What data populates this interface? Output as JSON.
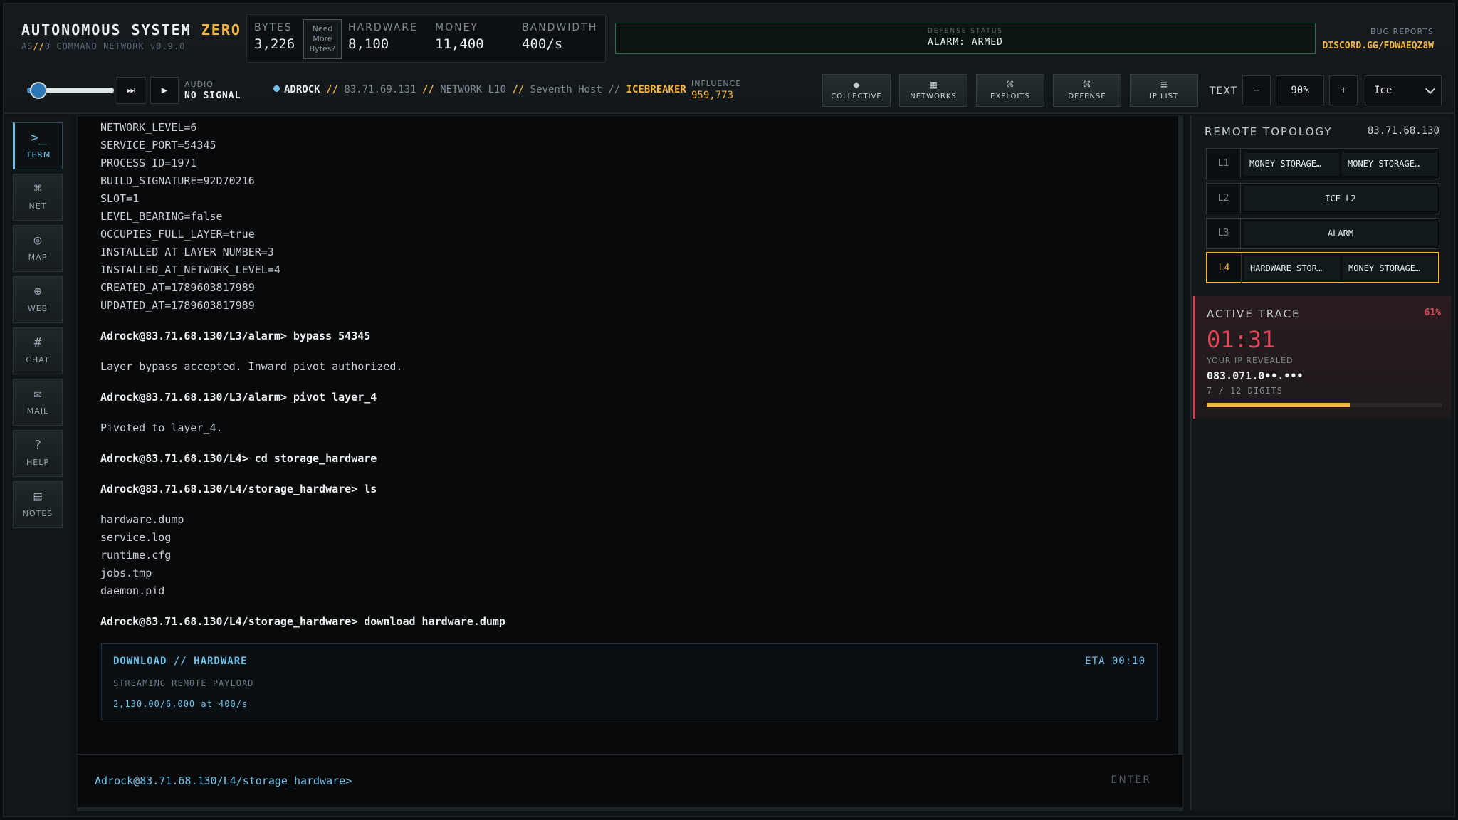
{
  "brand": {
    "title": "AUTONOMOUS SYSTEM",
    "title_accent": "ZERO",
    "sub_prefix": "AS",
    "sub_slash": "//",
    "sub_suffix": "0 COMMAND NETWORK",
    "version": "v0.9.0"
  },
  "resources": {
    "bytes_label": "BYTES",
    "bytes_value": "3,226",
    "need_more_label": "Need More Bytes?",
    "hardware_label": "HARDWARE",
    "hardware_value": "8,100",
    "money_label": "MONEY",
    "money_value": "11,400",
    "bandwidth_label": "BANDWIDTH",
    "bandwidth_value": "400/s"
  },
  "defense": {
    "label": "DEFENSE STATUS",
    "value": "ALARM: ARMED"
  },
  "bug_reports": {
    "label": "BUG REPORTS",
    "link": "DISCORD.GG/FDWAEQZ8W"
  },
  "audio": {
    "label": "AUDIO",
    "value": "NO SIGNAL",
    "skip_icon": "⏭",
    "play_icon": "▶",
    "volume_fraction": 0.1
  },
  "breadcrumb": {
    "user": "ADROCK",
    "sep": "//",
    "ip": "83.71.69.131",
    "network": "NETWORK L10",
    "host": "Seventh Host",
    "tool": "ICEBREAKER"
  },
  "influence": {
    "label": "INFLUENCE",
    "value": "959,773"
  },
  "nav": [
    {
      "icon": "◆",
      "label": "COLLECTIVE"
    },
    {
      "icon": "▦",
      "label": "NETWORKS"
    },
    {
      "icon": "⌘",
      "label": "EXPLOITS"
    },
    {
      "icon": "⌘",
      "label": "DEFENSE"
    },
    {
      "icon": "≡",
      "label": "IP LIST"
    }
  ],
  "text_controls": {
    "label": "TEXT",
    "minus": "−",
    "size": "90%",
    "plus": "+",
    "theme": "Ice"
  },
  "sidebar": [
    {
      "icon": ">_",
      "label": "TERM"
    },
    {
      "icon": "⌘",
      "label": "NET"
    },
    {
      "icon": "◎",
      "label": "MAP"
    },
    {
      "icon": "⊕",
      "label": "WEB"
    },
    {
      "icon": "#",
      "label": "CHAT"
    },
    {
      "icon": "✉",
      "label": "MAIL"
    },
    {
      "icon": "?",
      "label": "HELP"
    },
    {
      "icon": "▤",
      "label": "NOTES"
    }
  ],
  "terminal": {
    "lines": [
      {
        "t": "NETWORK_LEVEL=6",
        "k": "out"
      },
      {
        "t": "SERVICE_PORT=54345",
        "k": "out"
      },
      {
        "t": "PROCESS_ID=1971",
        "k": "out"
      },
      {
        "t": "BUILD_SIGNATURE=92D70216",
        "k": "out"
      },
      {
        "t": "SLOT=1",
        "k": "out"
      },
      {
        "t": "LEVEL_BEARING=false",
        "k": "out"
      },
      {
        "t": "OCCUPIES_FULL_LAYER=true",
        "k": "out"
      },
      {
        "t": "INSTALLED_AT_LAYER_NUMBER=3",
        "k": "out"
      },
      {
        "t": "INSTALLED_AT_NETWORK_LEVEL=4",
        "k": "out"
      },
      {
        "t": "CREATED_AT=1789603817989",
        "k": "out"
      },
      {
        "t": "UPDATED_AT=1789603817989",
        "k": "out"
      },
      {
        "t": "",
        "k": "gap"
      },
      {
        "t": "Adrock@83.71.68.130/L3/alarm> bypass 54345",
        "k": "cmd"
      },
      {
        "t": "",
        "k": "gap"
      },
      {
        "t": "Layer bypass accepted. Inward pivot authorized.",
        "k": "out"
      },
      {
        "t": "",
        "k": "gap"
      },
      {
        "t": "Adrock@83.71.68.130/L3/alarm> pivot layer_4",
        "k": "cmd"
      },
      {
        "t": "",
        "k": "gap"
      },
      {
        "t": "Pivoted to layer_4.",
        "k": "out"
      },
      {
        "t": "",
        "k": "gap"
      },
      {
        "t": "Adrock@83.71.68.130/L4> cd storage_hardware",
        "k": "cmd"
      },
      {
        "t": "",
        "k": "gap"
      },
      {
        "t": "Adrock@83.71.68.130/L4/storage_hardware> ls",
        "k": "cmd"
      },
      {
        "t": "",
        "k": "gap"
      },
      {
        "t": "hardware.dump",
        "k": "out"
      },
      {
        "t": "service.log",
        "k": "out"
      },
      {
        "t": "runtime.cfg",
        "k": "out"
      },
      {
        "t": "jobs.tmp",
        "k": "out"
      },
      {
        "t": "daemon.pid",
        "k": "out"
      },
      {
        "t": "",
        "k": "gap"
      },
      {
        "t": "Adrock@83.71.68.130/L4/storage_hardware> download hardware.dump",
        "k": "cmd"
      }
    ],
    "download": {
      "title": "DOWNLOAD // HARDWARE",
      "eta": "ETA 00:10",
      "subtitle": "STREAMING REMOTE PAYLOAD",
      "progress": "2,130.00/6,000 at 400/s"
    },
    "prompt": "Adrock@83.71.68.130/L4/storage_hardware>",
    "enter_label": "ENTER"
  },
  "topology": {
    "title": "REMOTE TOPOLOGY",
    "ip": "83.71.68.130",
    "layers": [
      {
        "num": "L1",
        "nodes": [
          "MONEY STORAGE…",
          "MONEY STORAGE…"
        ],
        "current": false
      },
      {
        "num": "L2",
        "nodes": [
          "ICE L2"
        ],
        "current": false
      },
      {
        "num": "L3",
        "nodes": [
          "ALARM"
        ],
        "current": false
      },
      {
        "num": "L4",
        "nodes": [
          "HARDWARE STOR…",
          "MONEY STORAGE…"
        ],
        "current": true
      }
    ]
  },
  "trace": {
    "title": "ACTIVE TRACE",
    "percent": "61%",
    "time": "01:31",
    "subtitle": "YOUR IP REVEALED",
    "ip": "083.071.0••.•••",
    "digits": "7 / 12 DIGITS",
    "progress_fraction": 0.61
  },
  "colors": {
    "accent": "#f3b440",
    "ice": "#6fc3ea",
    "alert": "#e5475a",
    "ok": "#2c6b4e"
  }
}
